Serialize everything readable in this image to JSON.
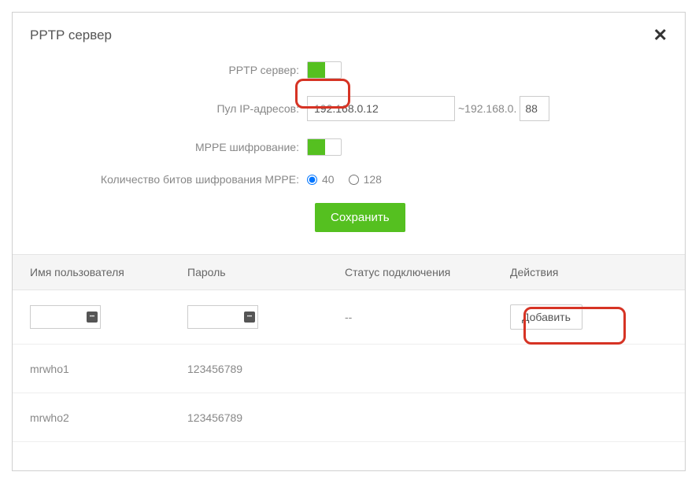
{
  "modal": {
    "title": "PPTP сервер"
  },
  "form": {
    "pptp_label": "PPTP сервер:",
    "ip_pool_label": "Пул IP-адресов:",
    "ip_pool_value": "192.168.0.12",
    "ip_pool_prefix": "~192.168.0.",
    "ip_pool_end": "88",
    "mppe_label": "MPPE шифрование:",
    "bits_label": "Количество битов шифрования MPPE:",
    "radio_40": "40",
    "radio_128": "128",
    "save": "Сохранить"
  },
  "table": {
    "headers": {
      "username": "Имя пользователя",
      "password": "Пароль",
      "status": "Статус подключения",
      "actions": "Действия"
    },
    "new_row": {
      "status_placeholder": "--",
      "add": "Добавить"
    },
    "rows": [
      {
        "username": "mrwho1",
        "password": "123456789"
      },
      {
        "username": "mrwho2",
        "password": "123456789"
      }
    ]
  }
}
